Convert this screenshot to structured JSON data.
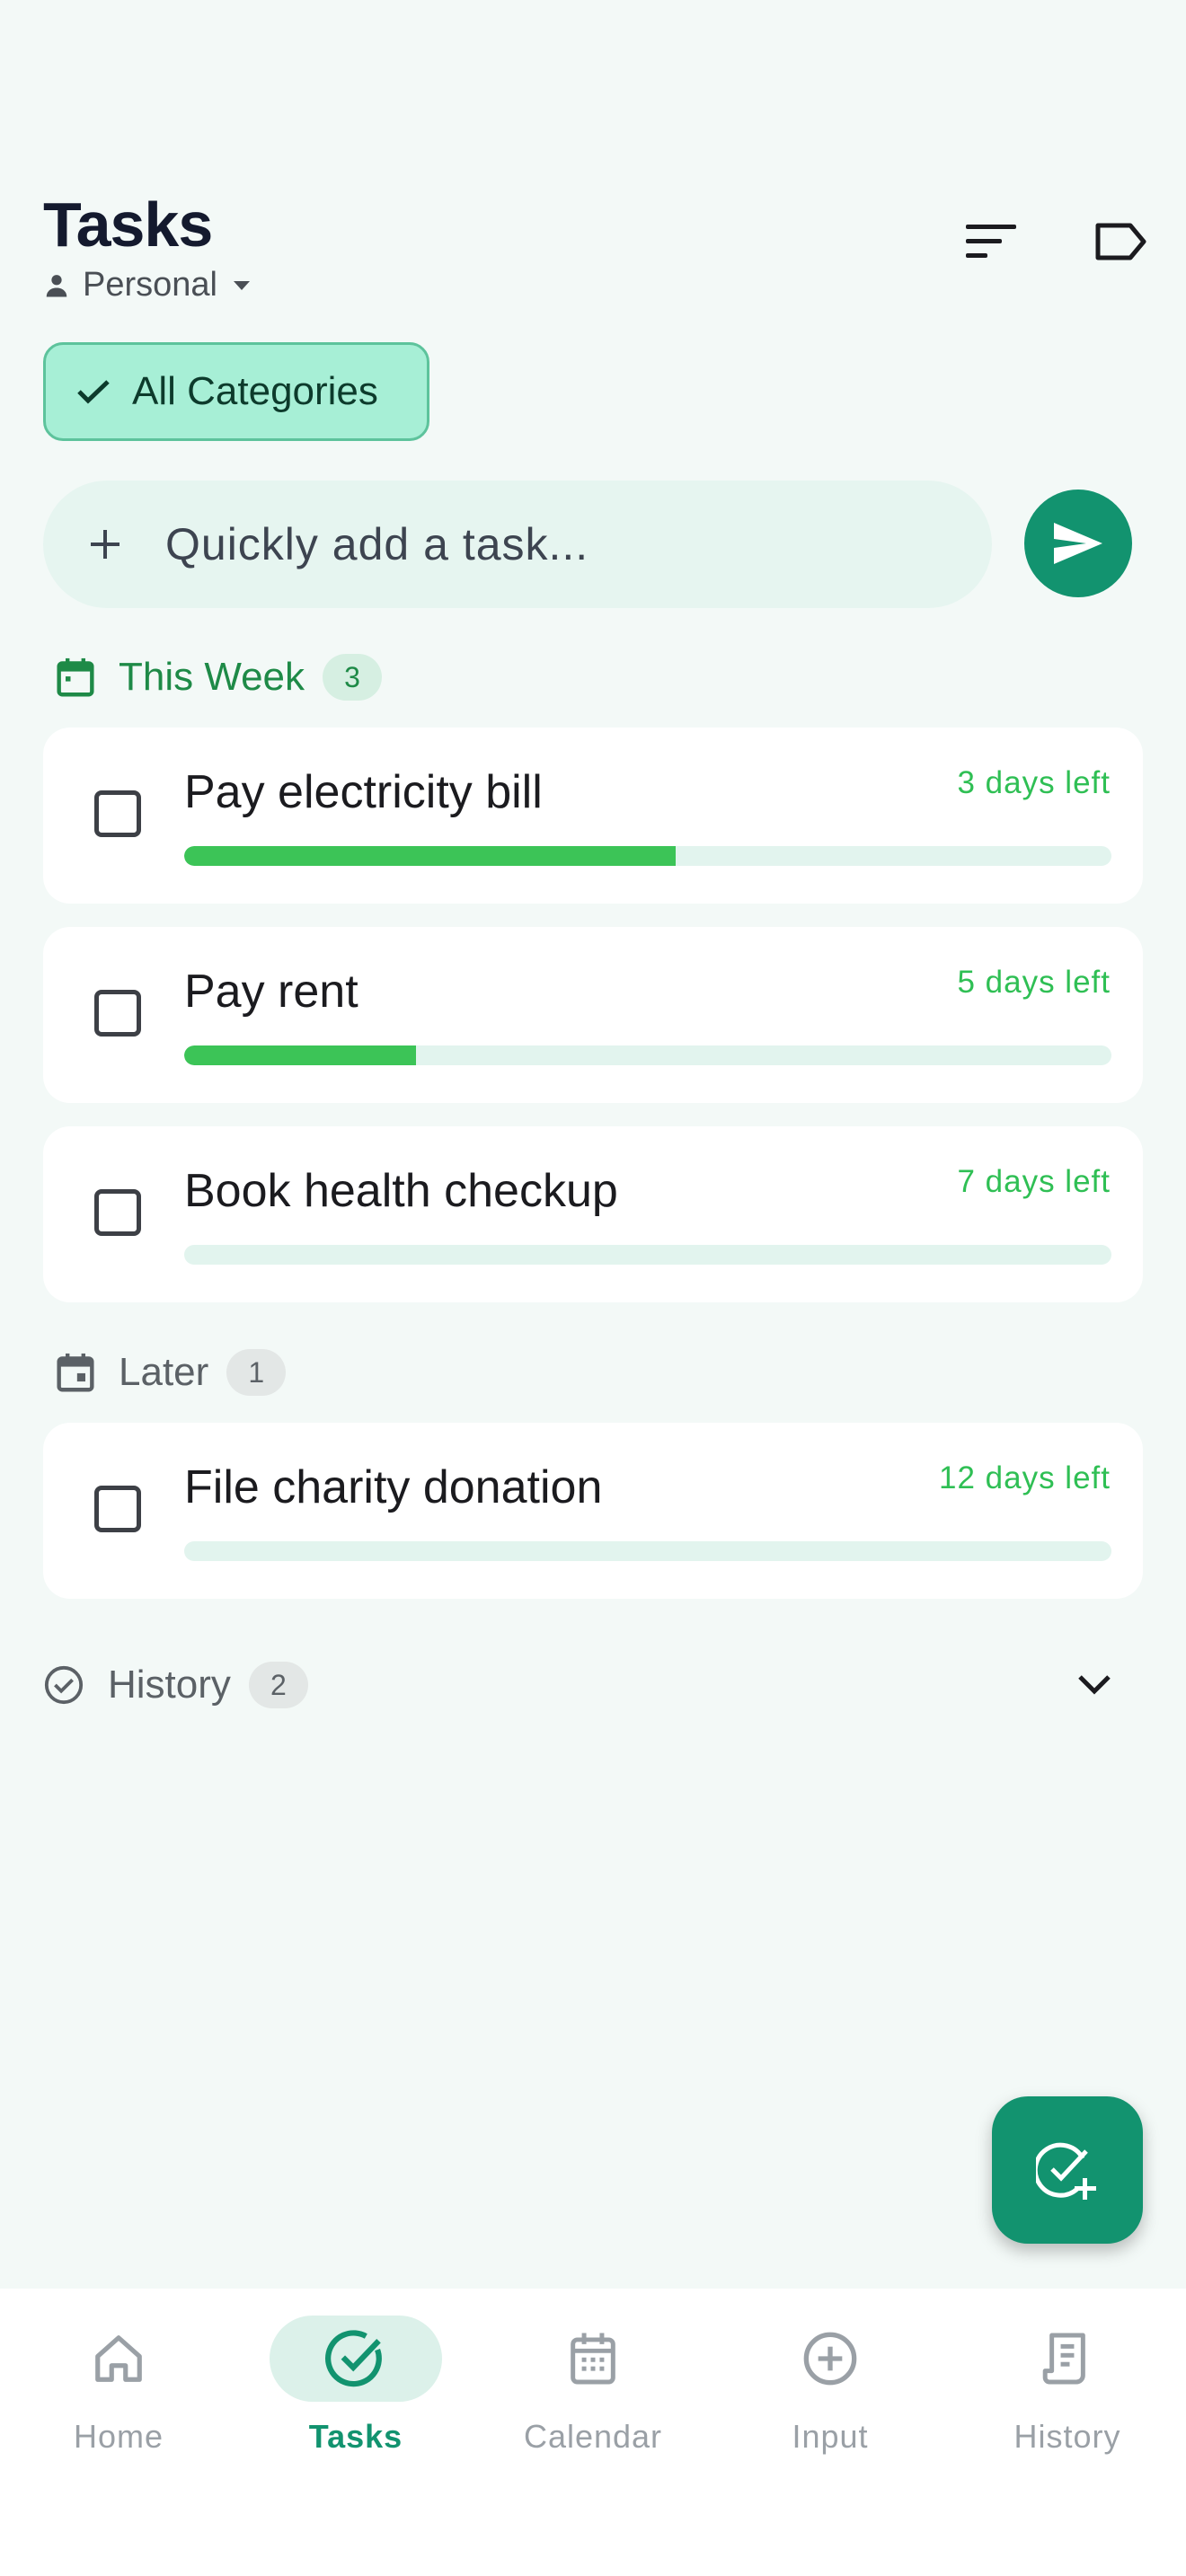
{
  "header": {
    "title": "Tasks",
    "profile": "Personal",
    "icons": [
      "sort-icon",
      "label-tag-icon"
    ]
  },
  "filter": {
    "chip_label": "All Categories"
  },
  "quick_add": {
    "placeholder": "Quickly add a task..."
  },
  "sections": [
    {
      "title": "This Week",
      "count": "3",
      "color": "#1e8a47",
      "tasks": [
        {
          "name": "Pay electricity bill",
          "due": "3 days left",
          "progress": 0.53
        },
        {
          "name": "Pay rent",
          "due": "5 days left",
          "progress": 0.25
        },
        {
          "name": "Book health checkup",
          "due": "7 days left",
          "progress": 0.0
        }
      ]
    },
    {
      "title": "Later",
      "count": "1",
      "color": "#5b6166",
      "tasks": [
        {
          "name": "File charity donation",
          "due": "12 days left",
          "progress": 0.0
        }
      ]
    }
  ],
  "history": {
    "label": "History",
    "count": "2"
  },
  "bottom_nav": [
    {
      "label": "Home",
      "icon": "home-icon",
      "active": false
    },
    {
      "label": "Tasks",
      "icon": "check-circle-icon",
      "active": true
    },
    {
      "label": "Calendar",
      "icon": "calendar-icon",
      "active": false
    },
    {
      "label": "Input",
      "icon": "add-circle-icon",
      "active": false
    },
    {
      "label": "History",
      "icon": "receipt-icon",
      "active": false
    }
  ],
  "colors": {
    "accent": "#12936f",
    "progress": "#3cc457",
    "due_text": "#2fbf54"
  }
}
